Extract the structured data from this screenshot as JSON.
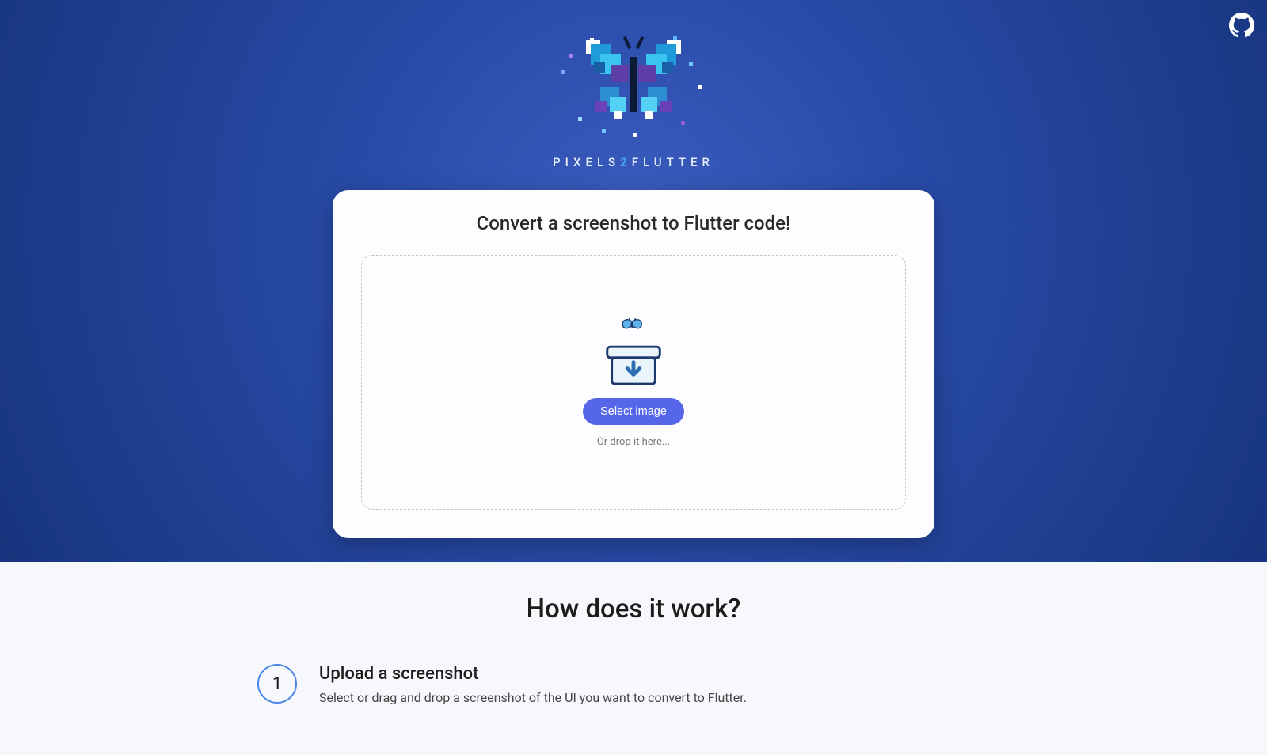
{
  "brand": {
    "part1": "PIXELS",
    "part2": "2",
    "part3": "FLUTTER"
  },
  "hero": {
    "card_title": "Convert a screenshot to Flutter code!",
    "select_button_label": "Select image",
    "drop_hint": "Or drop it here..."
  },
  "how": {
    "title": "How does it work?",
    "steps": [
      {
        "number": "1",
        "title": "Upload a screenshot",
        "desc": "Select or drag and drop a screenshot of the UI you want to convert to Flutter."
      }
    ]
  },
  "icons": {
    "github": "github-icon",
    "butterfly": "butterfly-logo-icon",
    "dropbox": "upload-box-icon"
  }
}
